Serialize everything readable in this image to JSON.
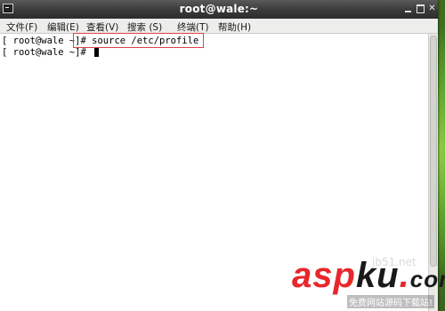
{
  "window": {
    "title": "root@wale:~"
  },
  "menu": {
    "items": [
      {
        "label": "文件(F)"
      },
      {
        "label": "编辑(E)"
      },
      {
        "label": "查看(V)"
      },
      {
        "label": "搜索 (S)"
      },
      {
        "label": "终端(T)"
      },
      {
        "label": "帮助(H)"
      }
    ]
  },
  "terminal": {
    "lines": [
      {
        "prompt": "[ root@wale ~]# ",
        "command": "source /etc/profile"
      },
      {
        "prompt": "[ root@wale ~]# ",
        "command": ""
      }
    ]
  },
  "watermark": {
    "brand_asp": "asp",
    "brand_ku": "ku",
    "brand_dot": ".",
    "brand_com": "com",
    "jb51": "jb51.net",
    "subtitle": "免费网站源码下载站!"
  },
  "colors": {
    "highlight_border": "#e0414b",
    "titlebar": "#3c3c3c",
    "menubar": "#ededeb"
  }
}
